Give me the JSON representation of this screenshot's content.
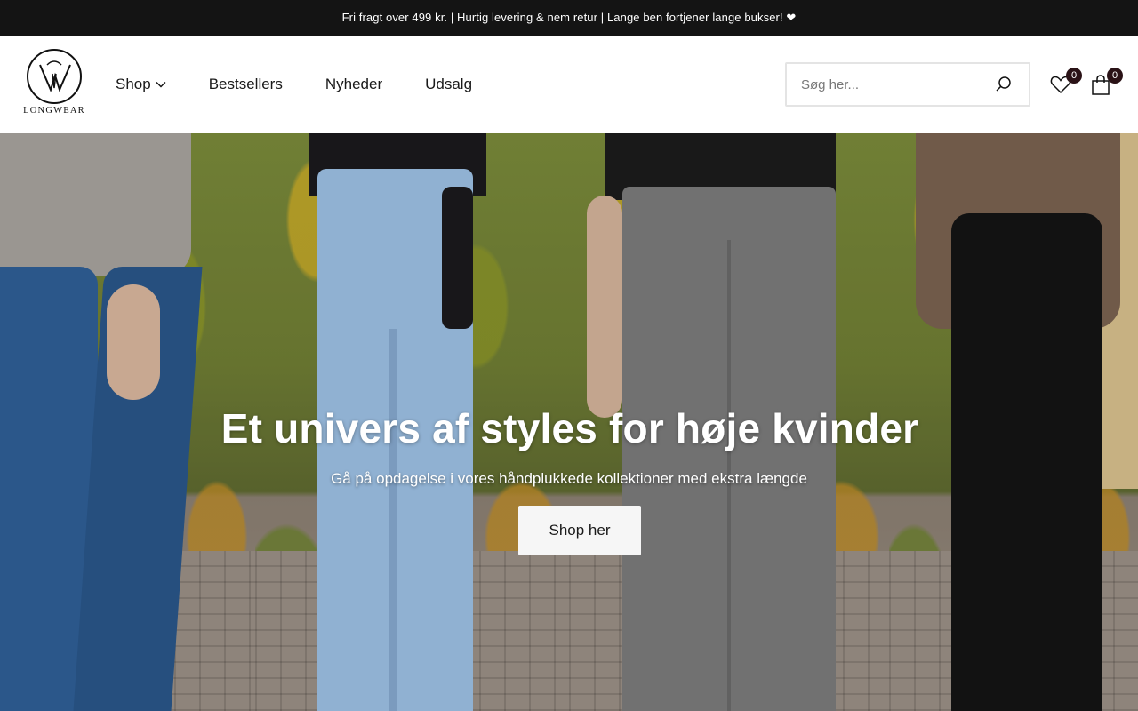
{
  "announcement": {
    "text": "Fri fragt over 499 kr. | Hurtig levering & nem retur | Lange ben fortjener lange bukser! ❤"
  },
  "header": {
    "logo_text": "LONGWEAR",
    "nav": [
      {
        "label": "Shop",
        "has_dropdown": true
      },
      {
        "label": "Bestsellers"
      },
      {
        "label": "Nyheder"
      },
      {
        "label": "Udsalg"
      }
    ],
    "search": {
      "placeholder": "Søg her..."
    },
    "wishlist_count": "0",
    "cart_count": "0"
  },
  "hero": {
    "title": "Et univers af styles for høje kvinder",
    "subtitle": "Gå på opdagelse i vores håndplukkede kollektioner med ekstra længde",
    "button_label": "Shop her"
  },
  "colors": {
    "announcement_bg": "#141414",
    "badge_bg": "#2a1216",
    "button_bg": "#f6f6f6"
  }
}
